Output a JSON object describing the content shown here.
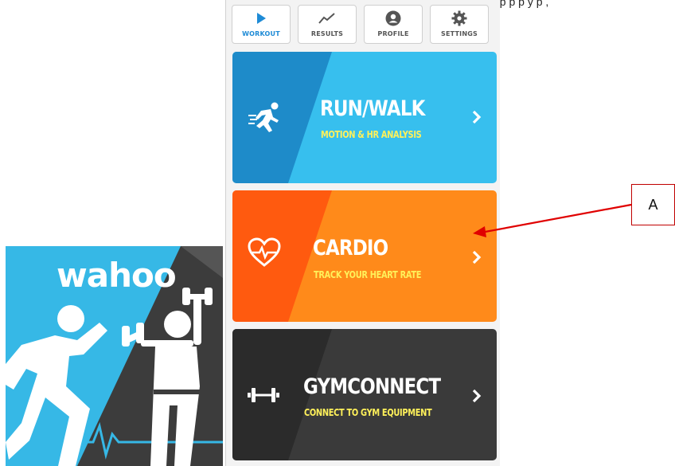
{
  "top_strip": {
    "text": "pp p p y   p , "
  },
  "tabs": [
    {
      "label": "WORKOUT",
      "icon": "play-icon",
      "active": true
    },
    {
      "label": "RESULTS",
      "icon": "trend-line-icon",
      "active": false
    },
    {
      "label": "PROFILE",
      "icon": "person-circle-icon",
      "active": false
    },
    {
      "label": "SETTINGS",
      "icon": "gear-icon",
      "active": false
    }
  ],
  "cards": [
    {
      "title": "RUN/WALK",
      "subtitle": "MOTION & HR ANALYSIS",
      "icon": "runner-icon",
      "color_left": "#1e8bc9",
      "color_right": "#37bfee"
    },
    {
      "title": "CARDIO",
      "subtitle": "TRACK YOUR HEART RATE",
      "icon": "heart-rate-icon",
      "color_left": "#ff5a0f",
      "color_right": "#ff8a1a"
    },
    {
      "title": "GYMCONNECT",
      "subtitle": "CONNECT TO GYM EQUIPMENT",
      "icon": "dumbbell-icon",
      "color_left": "#2b2b2b",
      "color_right": "#3a3a3a"
    }
  ],
  "annotation": {
    "label": "A",
    "color": "#e00000"
  },
  "logo": {
    "text": "wahoo",
    "color_blue": "#36b8e6",
    "color_dark": "#3c3c3c"
  }
}
